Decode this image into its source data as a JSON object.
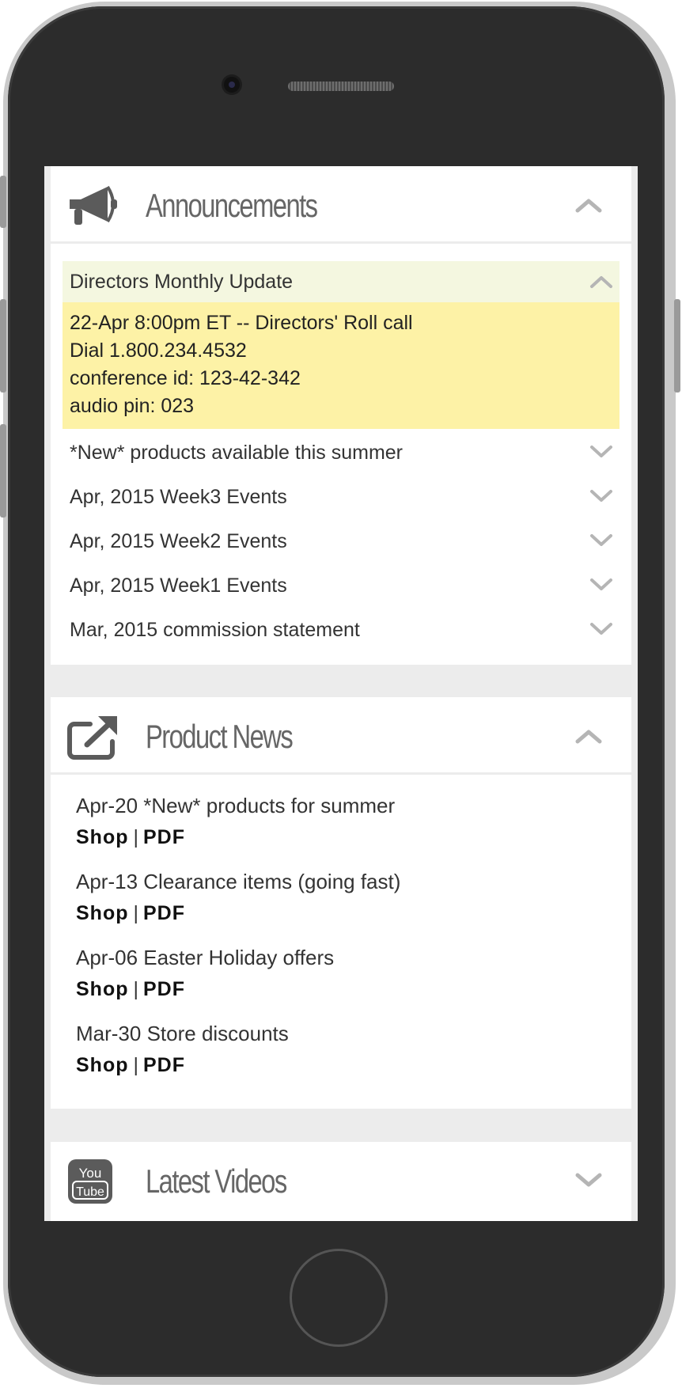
{
  "announcements": {
    "title": "Announcements",
    "icon": "megaphone-icon",
    "expanded_item": {
      "title": "Directors Monthly Update",
      "lines": [
        "22-Apr 8:00pm ET -- Directors' Roll call",
        "Dial 1.800.234.4532",
        "conference id: 123-42-342",
        "audio pin: 023"
      ]
    },
    "items": [
      "*New* products available this summer",
      "Apr, 2015 Week3 Events",
      "Apr, 2015 Week2 Events",
      "Apr, 2015 Week1 Events",
      "Mar, 2015 commission statement"
    ]
  },
  "product_news": {
    "title": "Product News",
    "icon": "external-link-icon",
    "items": [
      {
        "title": "Apr-20 *New* products for summer",
        "shop": "Shop",
        "sep": "|",
        "pdf": "PDF"
      },
      {
        "title": "Apr-13 Clearance items (going fast)",
        "shop": "Shop",
        "sep": "|",
        "pdf": "PDF"
      },
      {
        "title": "Apr-06 Easter Holiday offers",
        "shop": "Shop",
        "sep": "|",
        "pdf": "PDF"
      },
      {
        "title": "Mar-30 Store discounts",
        "shop": "Shop",
        "sep": "|",
        "pdf": "PDF"
      }
    ]
  },
  "latest_videos": {
    "title": "Latest Videos",
    "icon": "youtube-icon",
    "icon_text": [
      "You",
      "Tube"
    ]
  },
  "colors": {
    "highlight_header": "#f4f7e0",
    "highlight_body": "#fdf2a6",
    "title_gray": "#666666",
    "chevron_gray": "#b5b5b5"
  }
}
